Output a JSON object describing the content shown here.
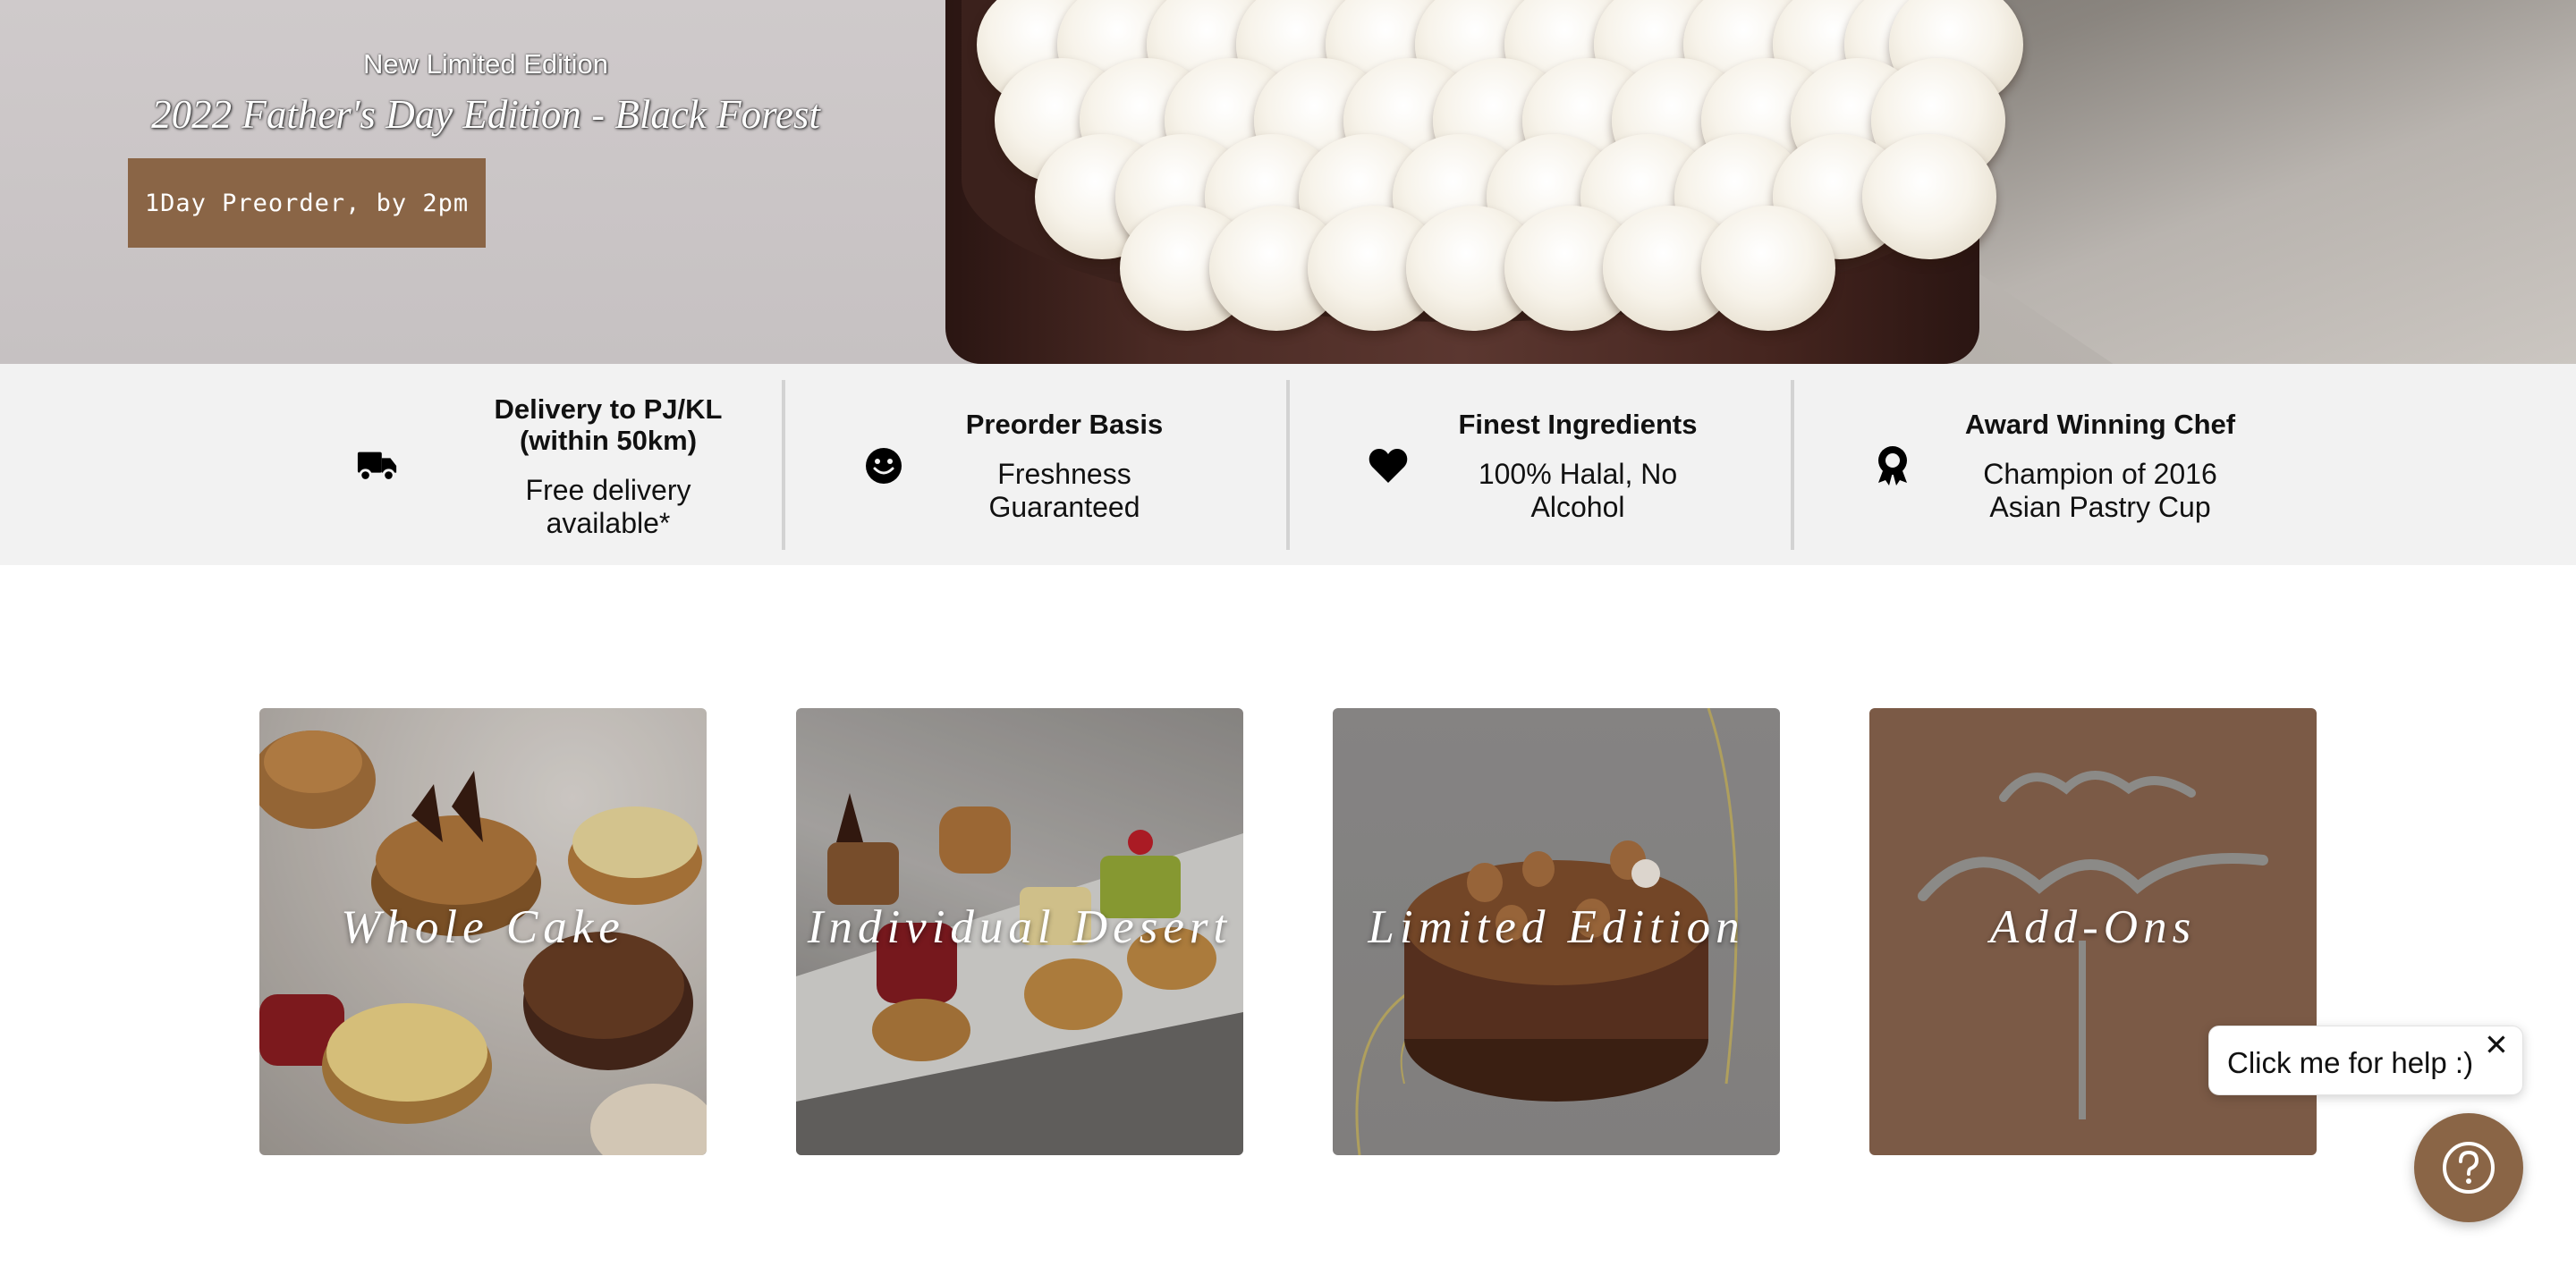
{
  "hero": {
    "kicker": "New Limited Edition",
    "title": "2022 Father's Day Edition - Black Forest",
    "button_label": "1Day Preorder, by 2pm"
  },
  "features": [
    {
      "icon": "truck-icon",
      "title": "Delivery to PJ/KL\n(within 50km)",
      "subtitle": "Free delivery\navailable*"
    },
    {
      "icon": "smiley-icon",
      "title": "Preorder Basis",
      "subtitle": "Freshness\nGuaranteed"
    },
    {
      "icon": "heart-icon",
      "title": "Finest Ingredients",
      "subtitle": "100% Halal, No\nAlcohol"
    },
    {
      "icon": "award-icon",
      "title": "Award Winning Chef",
      "subtitle": "Champion of 2016\nAsian Pastry Cup"
    }
  ],
  "categories": [
    {
      "label": "Whole Cake"
    },
    {
      "label": "Individual Desert"
    },
    {
      "label": "Limited Edition"
    },
    {
      "label": "Add-Ons"
    }
  ],
  "help": {
    "bubble_text": "Click me for help :)",
    "close_symbol": "✕"
  },
  "colors": {
    "brand_brown": "#8a6546",
    "feature_bar_bg": "#f2f2f2"
  }
}
